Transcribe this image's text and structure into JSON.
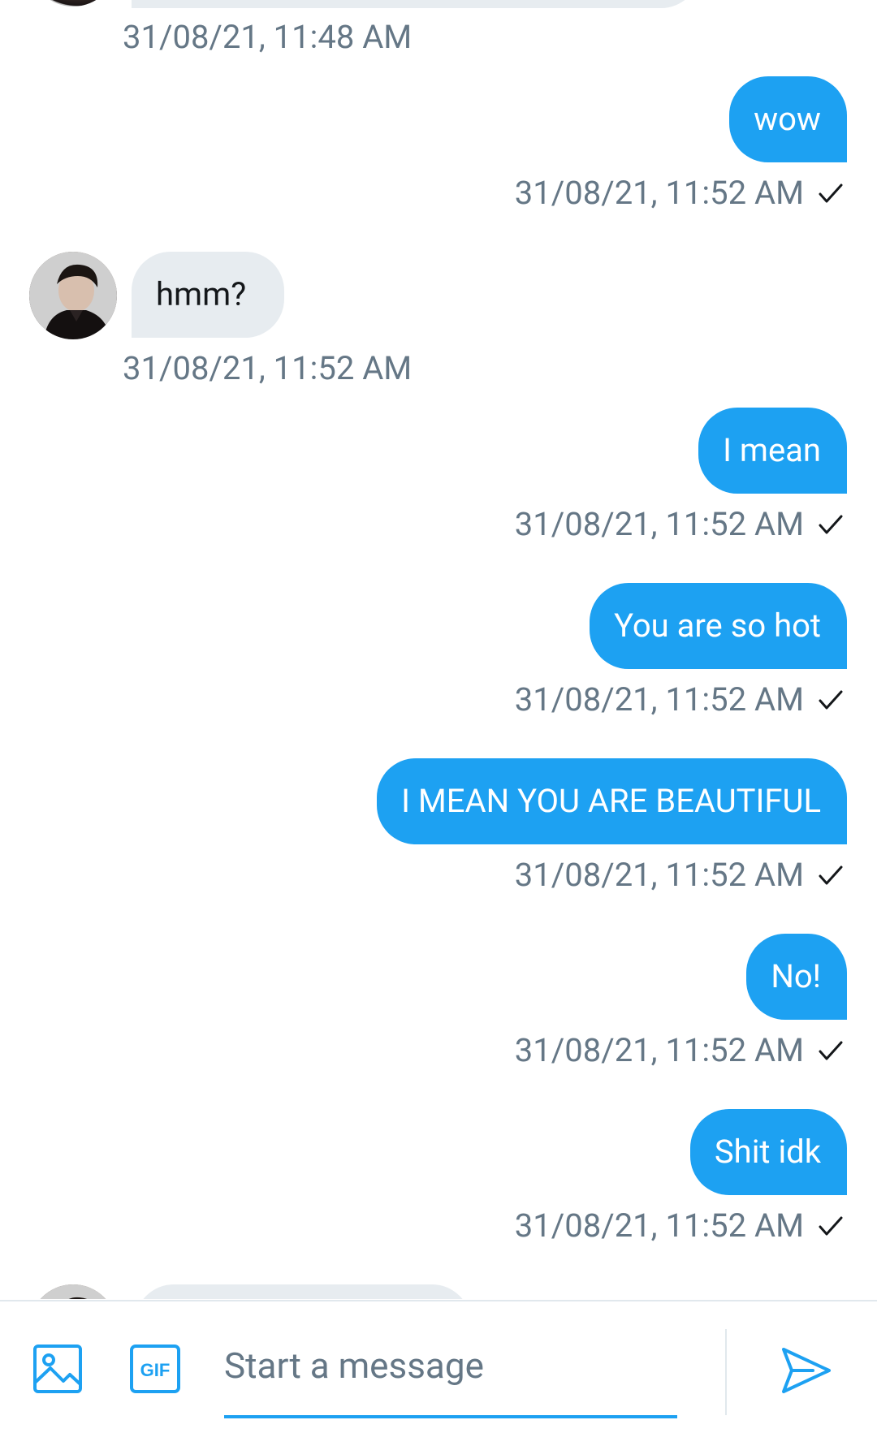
{
  "theme": {
    "accent": "#1da1f2",
    "incoming_bubble": "#e7ecf0",
    "timestamp_color": "#657786"
  },
  "messages": [
    {
      "direction": "in",
      "text": "",
      "timestamp": "31/08/21, 11:48 AM",
      "partial": true
    },
    {
      "direction": "out",
      "text": "wow",
      "timestamp": "31/08/21, 11:52 AM",
      "status_icon": "check-icon"
    },
    {
      "direction": "in",
      "text": "hmm?",
      "timestamp": "31/08/21, 11:52 AM"
    },
    {
      "direction": "out",
      "text": "I mean",
      "timestamp": "31/08/21, 11:52 AM",
      "status_icon": "check-icon"
    },
    {
      "direction": "out",
      "text": "You are so hot",
      "timestamp": "31/08/21, 11:52 AM",
      "status_icon": "check-icon"
    },
    {
      "direction": "out",
      "text": "I MEAN YOU ARE BEAUTIFUL",
      "timestamp": "31/08/21, 11:52 AM",
      "status_icon": "check-icon"
    },
    {
      "direction": "out",
      "text": "No!",
      "timestamp": "31/08/21, 11:52 AM",
      "status_icon": "check-icon"
    },
    {
      "direction": "out",
      "text": "Shit idk",
      "timestamp": "31/08/21, 11:52 AM",
      "status_icon": "check-icon"
    },
    {
      "direction": "in",
      "text": "",
      "partial": true
    }
  ],
  "composer": {
    "media_icon": "image-icon",
    "gif_icon": "gif-icon",
    "gif_label": "GIF",
    "placeholder": "Start a message",
    "send_icon": "send-icon"
  }
}
